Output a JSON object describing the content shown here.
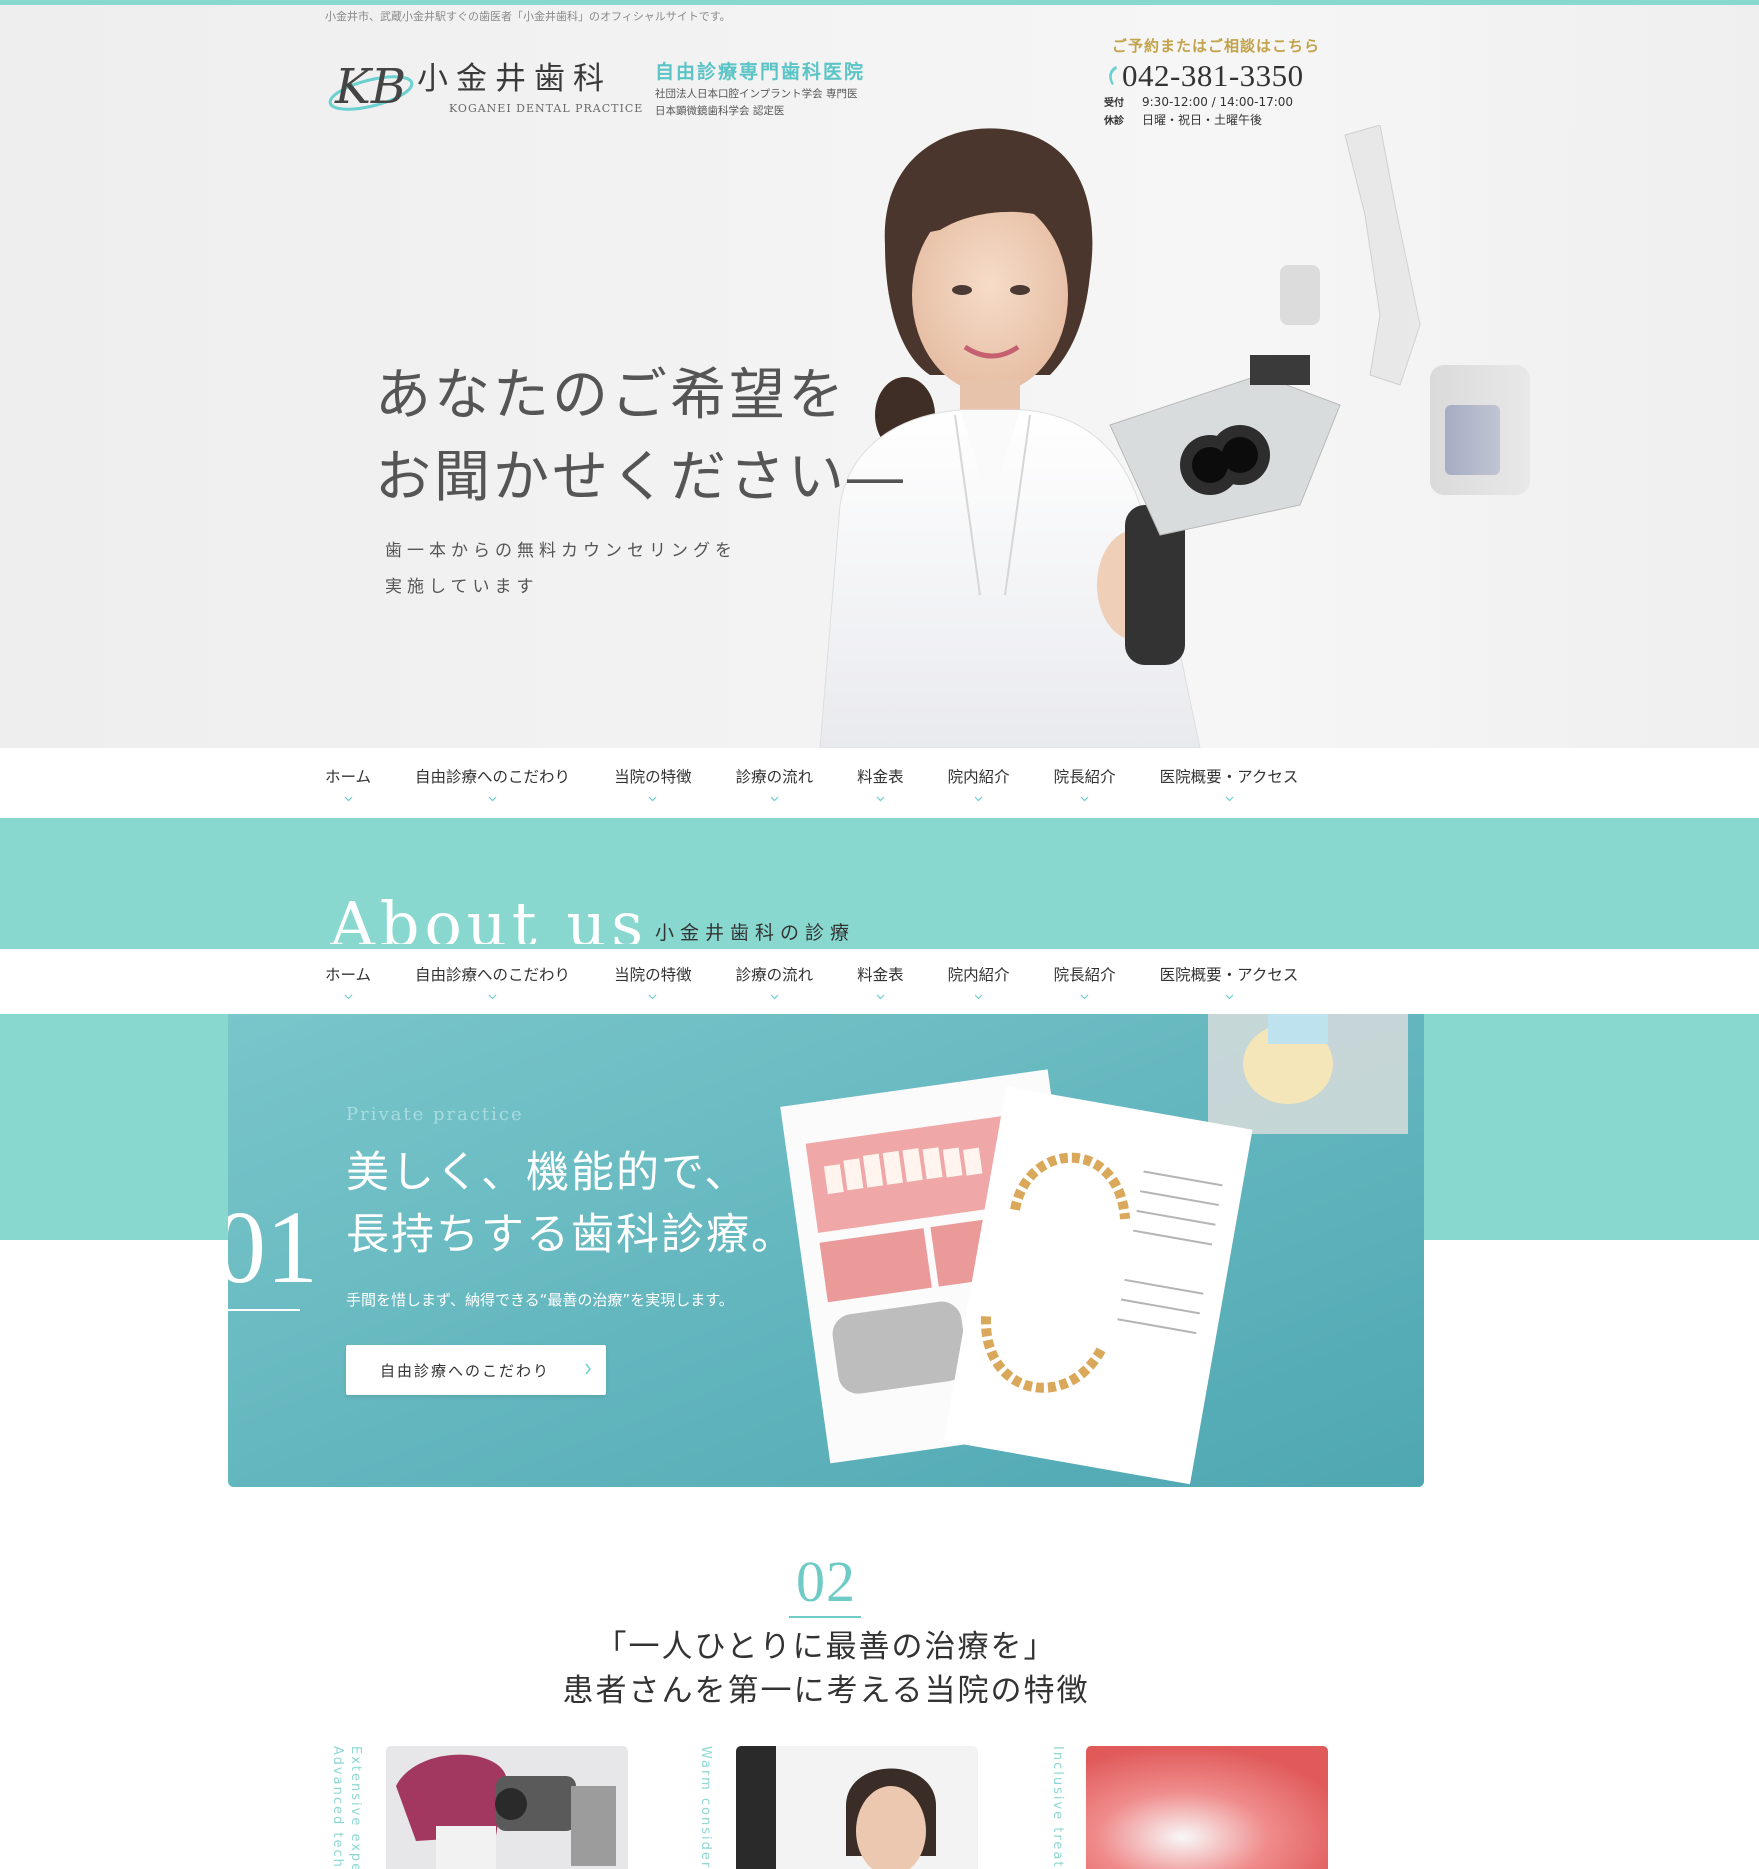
{
  "header": {
    "tagline": "小金井市、武蔵小金井駅すぐの歯医者「小金井歯科」のオフィシャルサイトです。",
    "logo_mark": "KB",
    "logo_name": "小金井歯科",
    "logo_en": "KOGANEI DENTAL PRACTICE",
    "logo_sub": "自由診療専門歯科医院",
    "cert_1": "社団法人日本口腔インプラント学会 専門医",
    "cert_2": "日本顕微鏡歯科学会 認定医"
  },
  "contact": {
    "label": "ご予約またはご相談はこちら",
    "phone": "042-381-3350",
    "hours_label": "受付",
    "hours": "9:30-12:00 / 14:00-17:00",
    "closed_label": "休診",
    "closed": "日曜・祝日・土曜午後"
  },
  "hero": {
    "heading_line1": "あなたのご希望を",
    "heading_line2": "お聞かせください―",
    "sub_line1": "歯一本からの無料カウンセリングを",
    "sub_line2": "実施しています"
  },
  "nav": {
    "items": [
      {
        "label": "ホーム"
      },
      {
        "label": "自由診療へのこだわり"
      },
      {
        "label": "当院の特徴"
      },
      {
        "label": "診療の流れ"
      },
      {
        "label": "料金表"
      },
      {
        "label": "院内紹介"
      },
      {
        "label": "院長紹介"
      },
      {
        "label": "医院概要・アクセス"
      }
    ]
  },
  "about": {
    "en": "About us",
    "jp": "小金井歯科の診療"
  },
  "card1": {
    "en": "Private practice",
    "head_line1": "美しく、機能的で、",
    "head_line2": "長持ちする歯科診療。",
    "num": "01",
    "text": "手間を惜しまず、納得できる“最善の治療”を実現します。",
    "button": "自由診療へのこだわり"
  },
  "section2": {
    "num": "02",
    "title_line1": "「一人ひとりに最善の治療を」",
    "title_line2": "患者さんを第一に考える当院の特徴"
  },
  "features": [
    {
      "vertical": "Advanced techn..."
    },
    {
      "vertical": "Warm considera..."
    },
    {
      "vertical": "Inclusive treatm..."
    }
  ],
  "feature_vert_full": [
    "Advanced techn",
    "Extensive exper",
    "Warm consider",
    "Inclusive treatm"
  ],
  "colors": {
    "accent": "#88d8d0",
    "teal_dark": "#5eb5bd",
    "gold": "#c2a24a",
    "logo_sub": "#5bc4c6"
  }
}
